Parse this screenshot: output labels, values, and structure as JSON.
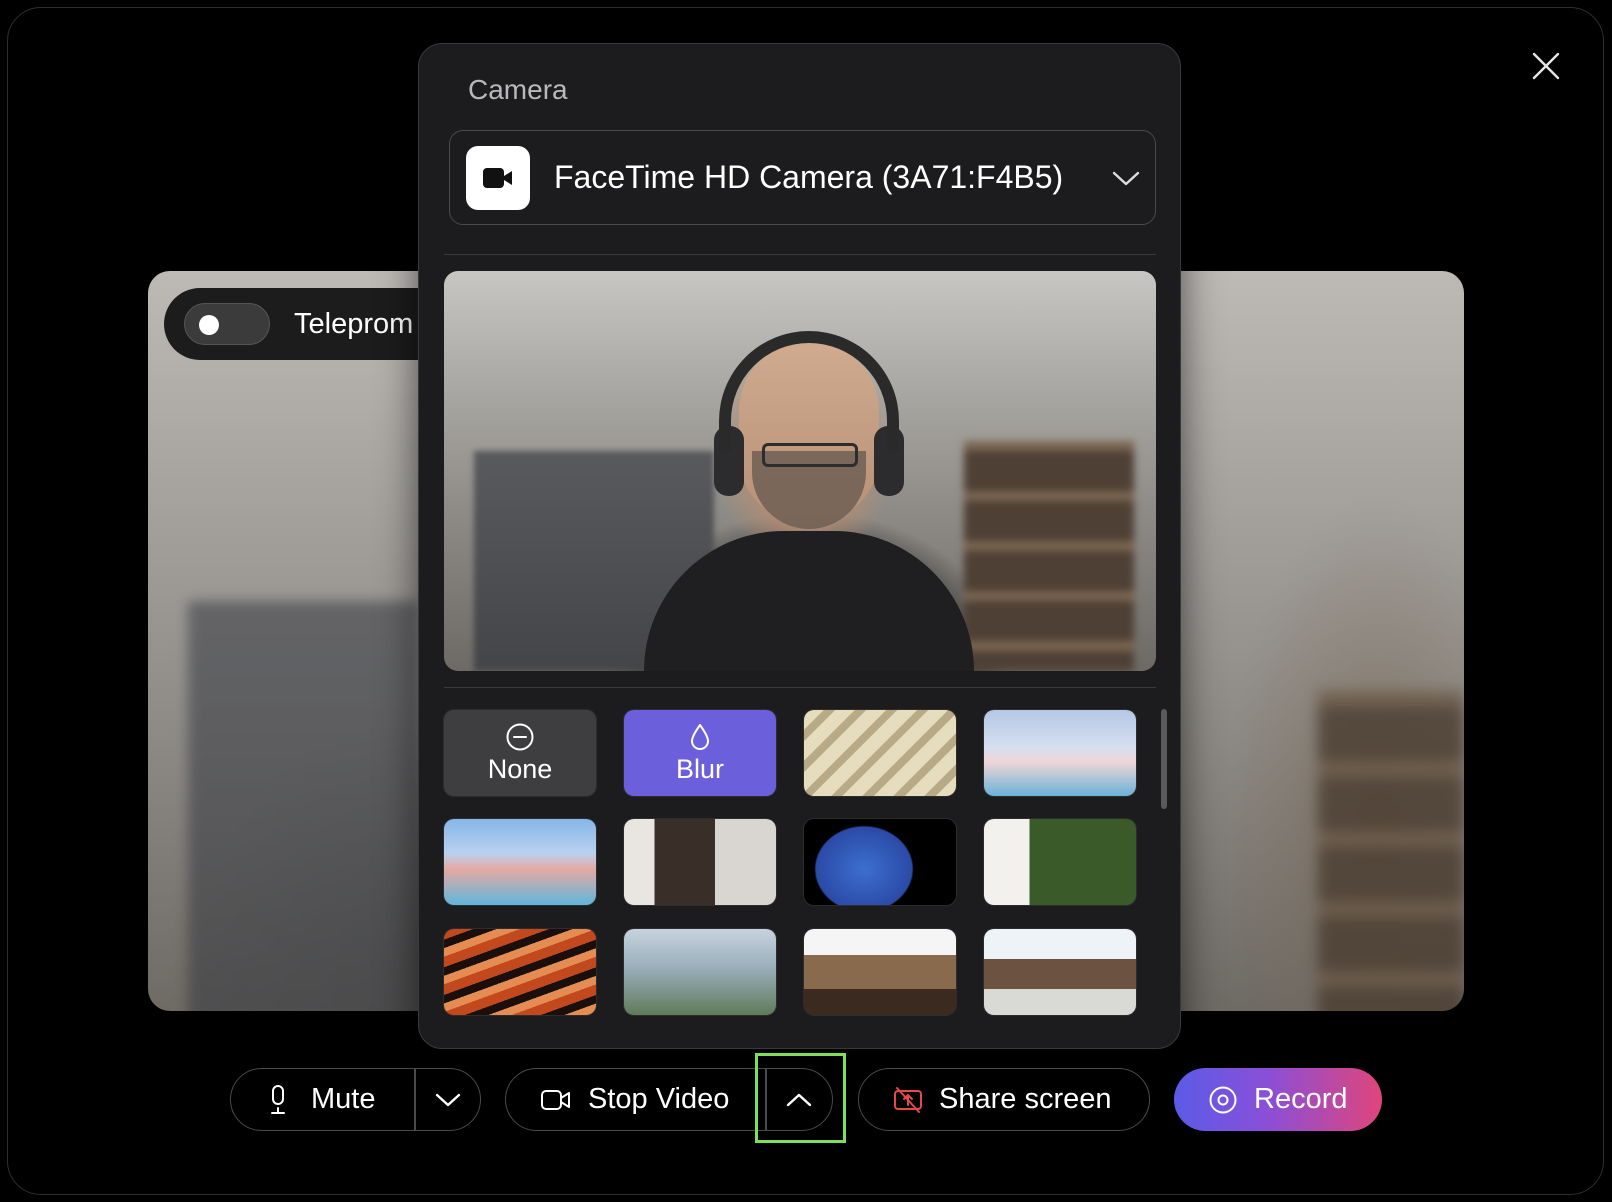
{
  "window": {
    "close_icon": "close-icon"
  },
  "teleprompter": {
    "label": "Teleprom",
    "enabled": false
  },
  "camera_popup": {
    "heading": "Camera",
    "selected_camera": "FaceTime HD Camera (3A71:F4B5)",
    "backgrounds": [
      {
        "label": "None",
        "icon": "minus-circle-icon"
      },
      {
        "label": "Blur",
        "icon": "droplet-icon",
        "selected": true
      }
    ],
    "accent_color": "#6c5fdc"
  },
  "toolbar": {
    "mute_label": "Mute",
    "stop_video_label": "Stop Video",
    "share_screen_label": "Share screen",
    "record_label": "Record",
    "share_icon_color": "#e5484d"
  }
}
